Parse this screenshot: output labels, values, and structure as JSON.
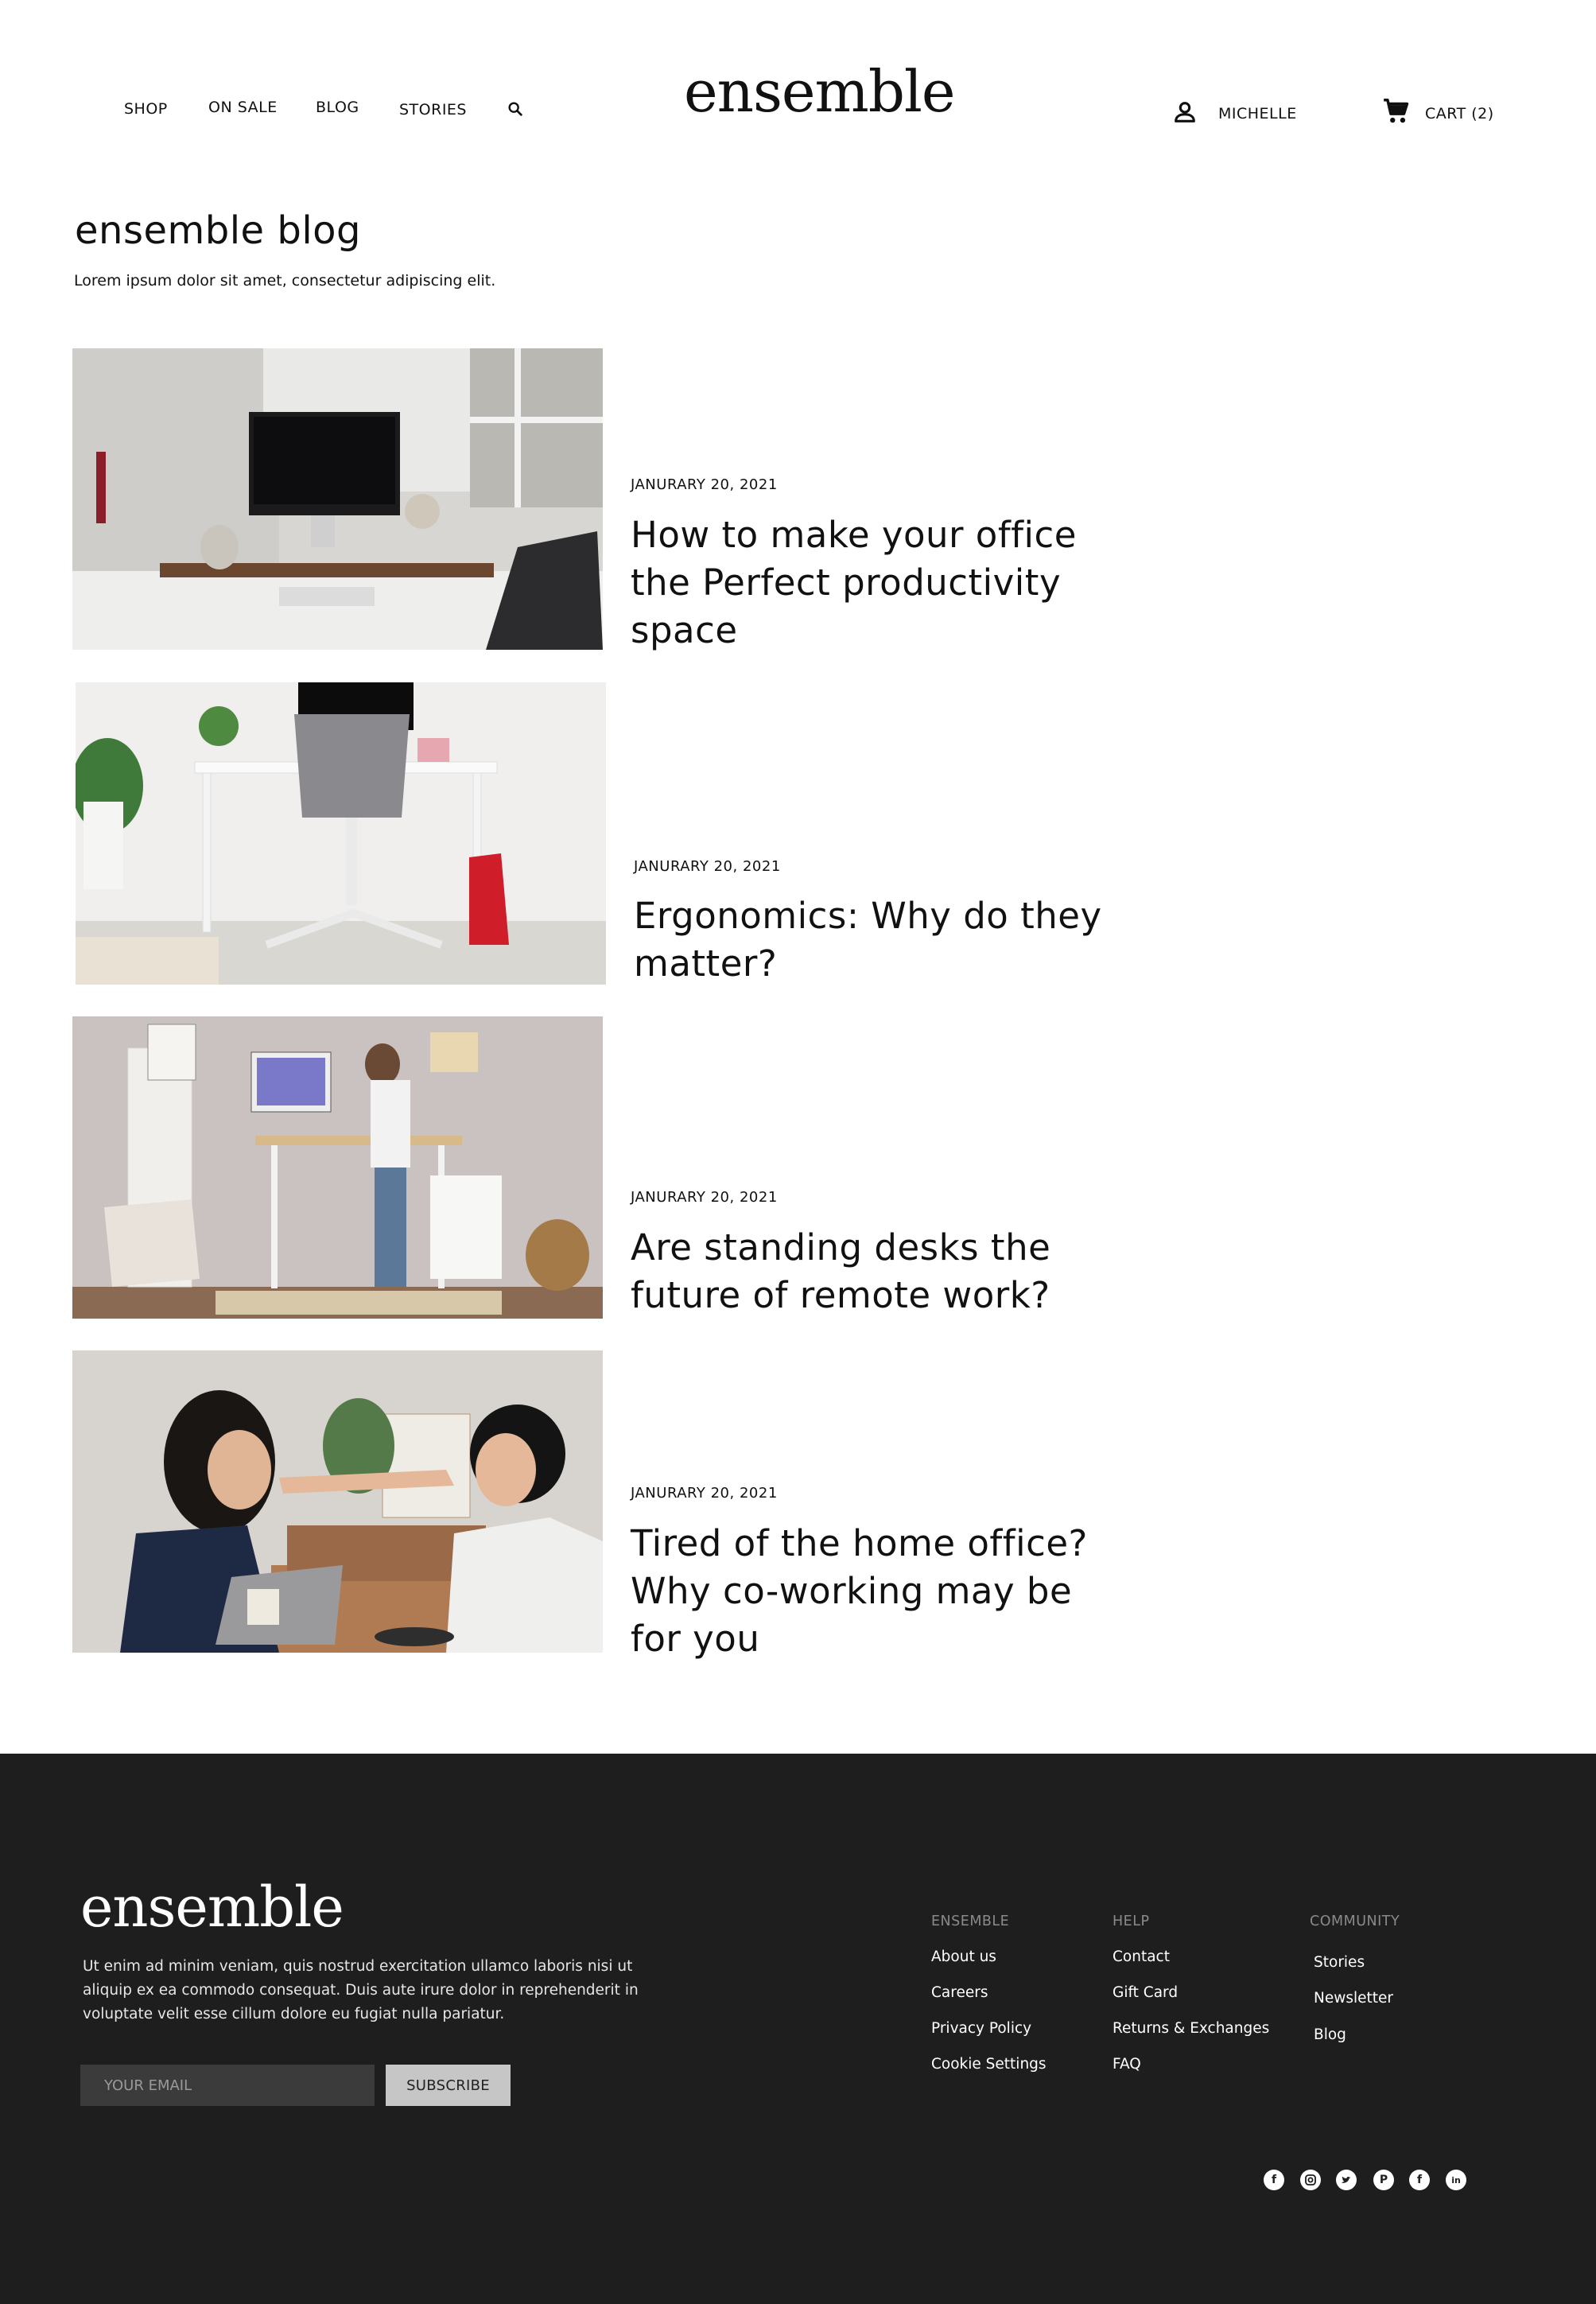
{
  "header": {
    "nav": [
      "SHOP",
      "ON SALE",
      "BLOG",
      "STORIES"
    ],
    "logo": "ensemble",
    "user_name": "MICHELLE",
    "cart_label": "CART (2)"
  },
  "blog": {
    "title": "ensemble blog",
    "subtitle": "Lorem ipsum dolor sit amet, consectetur adipiscing elit."
  },
  "posts": [
    {
      "date": "JANURARY 20, 2021",
      "title": "How to make your office the Perfect productivity space"
    },
    {
      "date": "JANURARY 20, 2021",
      "title": "Ergonomics: Why do they matter?"
    },
    {
      "date": "JANURARY 20, 2021",
      "title": "Are standing desks the future of remote work?"
    },
    {
      "date": "JANURARY 20, 2021",
      "title": "Tired of the home office? Why co-working may be for you"
    }
  ],
  "footer": {
    "logo": "ensemble",
    "about": "Ut enim ad minim veniam, quis nostrud exercitation ullamco laboris nisi ut aliquip ex ea commodo consequat. Duis aute irure dolor in reprehenderit in voluptate velit esse cillum dolore eu fugiat nulla pariatur.",
    "email_placeholder": "YOUR EMAIL",
    "subscribe_label": "SUBSCRIBE",
    "columns": [
      {
        "heading": "ENSEMBLE",
        "links": [
          "About us",
          "Careers",
          "Privacy Policy",
          "Cookie Settings"
        ]
      },
      {
        "heading": "HELP",
        "links": [
          "Contact",
          "Gift Card",
          "Returns & Exchanges",
          "FAQ"
        ]
      },
      {
        "heading": "COMMUNITY",
        "links": [
          "Stories",
          "Newsletter",
          "Blog"
        ]
      }
    ],
    "social_icons": [
      "facebook-icon",
      "instagram-icon",
      "twitter-icon",
      "pinterest-icon",
      "facebook-icon",
      "linkedin-icon"
    ]
  },
  "colors": {
    "footer_bg": "#1e1e1e",
    "subscribe_bg": "#c6c6c6",
    "email_bg": "#3b3b3b"
  }
}
